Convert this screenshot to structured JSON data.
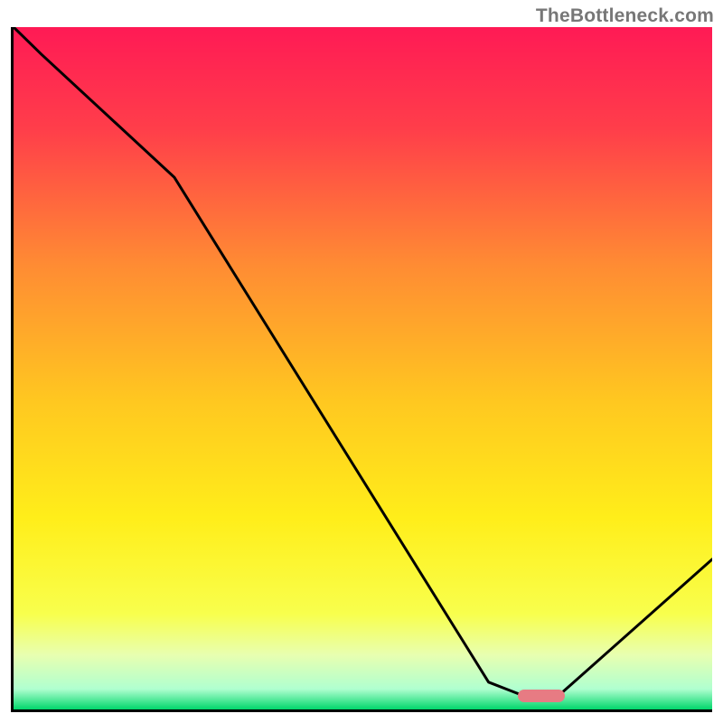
{
  "watermark": "TheBottleneck.com",
  "chart_data": {
    "type": "line",
    "x": [
      0.0,
      0.04,
      0.23,
      0.68,
      0.73,
      0.78,
      1.0
    ],
    "values": [
      1.0,
      0.96,
      0.78,
      0.04,
      0.02,
      0.02,
      0.22
    ],
    "xlabel": "",
    "ylabel": "",
    "title": "",
    "xlim": [
      0,
      1
    ],
    "ylim": [
      0,
      1
    ],
    "marker": {
      "x": 0.755,
      "y": 0.02
    },
    "gradient_stops": [
      {
        "offset": 0,
        "color": "#ff1a55"
      },
      {
        "offset": 0.15,
        "color": "#ff3e4a"
      },
      {
        "offset": 0.35,
        "color": "#ff8c33"
      },
      {
        "offset": 0.55,
        "color": "#ffc820"
      },
      {
        "offset": 0.72,
        "color": "#ffee1a"
      },
      {
        "offset": 0.86,
        "color": "#f8ff4d"
      },
      {
        "offset": 0.92,
        "color": "#e8ffb0"
      },
      {
        "offset": 0.97,
        "color": "#b0ffd0"
      },
      {
        "offset": 1.0,
        "color": "#00d66b"
      }
    ]
  }
}
